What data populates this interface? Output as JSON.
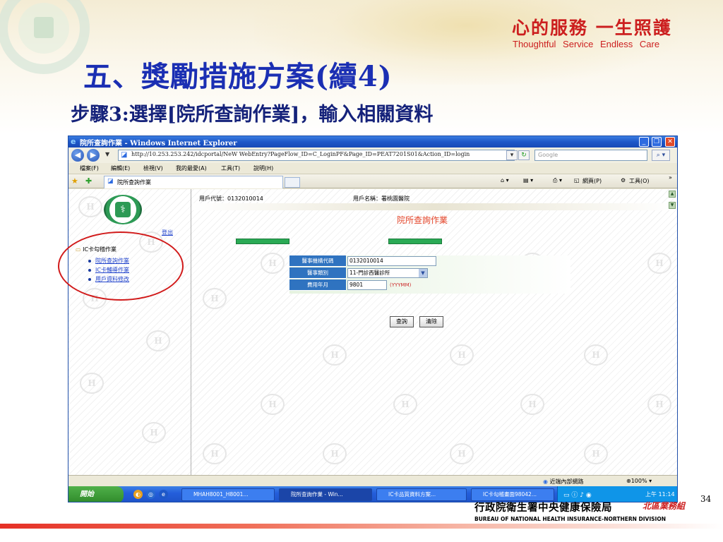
{
  "slide": {
    "slogan_cn": "心的服務 一生照護",
    "slogan_en": "Thoughtful Service Endless Care",
    "title": "五、獎勵措施方案(續4)",
    "subtitle_step": "步驟3:",
    "subtitle_text": "選擇[院所查詢作業]，輸入相關資料",
    "page_number": "34",
    "footer_agency": "行政院衛生署中央健康保險局",
    "footer_division": "北區業務組",
    "footer_en": "BUREAU OF NATIONAL HEALTH INSURANCE-NORTHERN DIVISION"
  },
  "browser": {
    "window_title": "院所查詢作業 - Windows Internet Explorer",
    "url": "http://10.253.253.242/idcportal/NeW WebEntry?PageFlow_ID=C_LoginPF&Page_ID=PEAT7201S01&Action_ID=login",
    "search_placeholder": "Google",
    "menu": [
      "檔案(F)",
      "編輯(E)",
      "檢視(V)",
      "我的最愛(A)",
      "工具(T)",
      "說明(H)"
    ],
    "tab_label": "院所查詢作業",
    "commands": {
      "page": "網頁(P)",
      "tools": "工具(O)"
    },
    "status_zone": "近端內部網路",
    "zoom": "100%"
  },
  "page": {
    "logout": "登出",
    "tree_root": "IC卡勾稽作業",
    "tree_items": [
      "院所查詢作業",
      "IC卡輔導作業",
      "用戶資料修改"
    ],
    "user_code": "用戶代號：0132010014",
    "user_name": "用戶名稱：署桃園醫院",
    "form_title": "院所查詢作業",
    "form": {
      "labels": [
        "醫事機構代碼",
        "醫事類別",
        "費用年月"
      ],
      "values": [
        "0132010014",
        "11-門診西醫診所",
        "9801"
      ],
      "date_hint": "(YYYMM)"
    },
    "buttons": {
      "query": "查詢",
      "clear": "清除"
    },
    "watermark_glyph": "H"
  },
  "taskbar": {
    "start": "開始",
    "items": [
      "MHAH8001_H8001...",
      "院所查詢作業 - Win...",
      "IC卡品質資料方案...",
      "IC卡勾稽畫面98042..."
    ],
    "time": "上午 11:14"
  },
  "colors": {
    "slogan_red": "#cc1f1f",
    "title_blue": "#1b2fb3",
    "form_label_blue": "#2f73c0",
    "form_title_red": "#e4452a",
    "bar_green": "#2aaa55",
    "highlight_oval": "#d11a1a"
  }
}
